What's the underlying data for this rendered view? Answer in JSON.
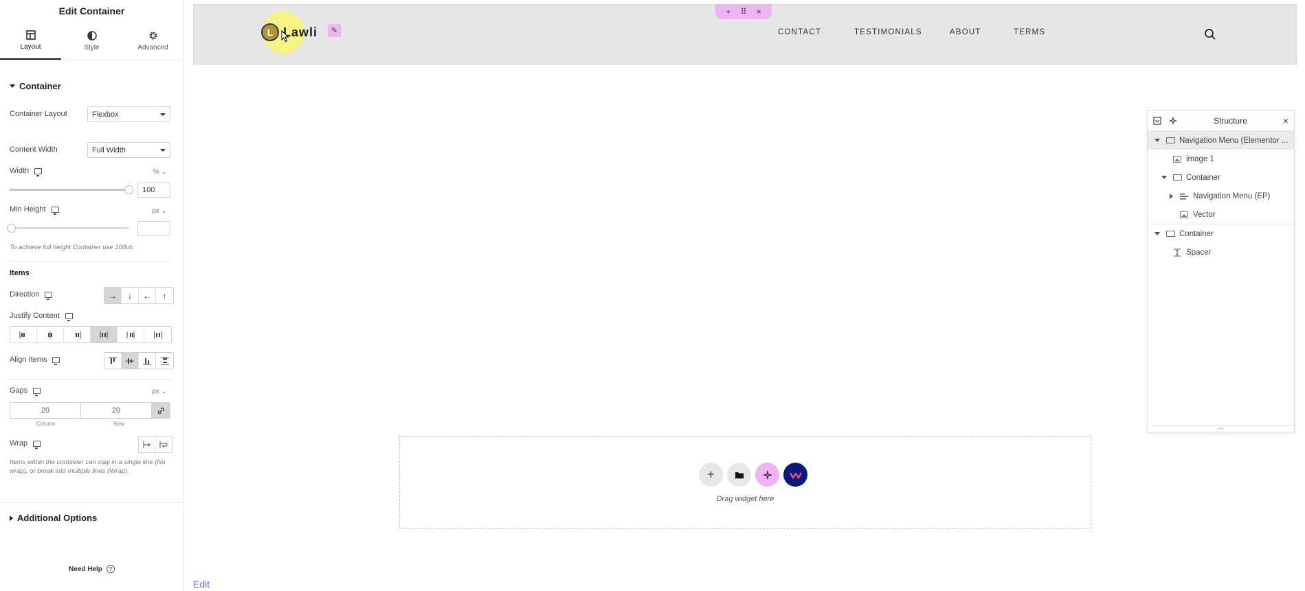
{
  "panel": {
    "title": "Edit Container",
    "tabs": [
      {
        "label": "Layout",
        "icon": "layout-icon",
        "active": true
      },
      {
        "label": "Style",
        "icon": "style-icon"
      },
      {
        "label": "Advanced",
        "icon": "gear-icon"
      }
    ],
    "section_container": "Container",
    "container_layout": {
      "label": "Container Layout",
      "value": "Flexbox"
    },
    "content_width": {
      "label": "Content Width",
      "value": "Full Width"
    },
    "width": {
      "label": "Width",
      "unit": "%",
      "value": "100",
      "slider_fraction": 1.0
    },
    "min_height": {
      "label": "Min Height",
      "unit": "px",
      "value": "",
      "hint": "To achieve full height Container use 100vh."
    },
    "items_heading": "Items",
    "direction": {
      "label": "Direction",
      "options": [
        "→",
        "↓",
        "←",
        "↑"
      ],
      "selected": 0
    },
    "justify_content": {
      "label": "Justify Content",
      "selected": 3
    },
    "align_items": {
      "label": "Align Items",
      "selected": 1
    },
    "gaps": {
      "label": "Gaps",
      "unit": "px",
      "column": "20",
      "row": "20",
      "column_label": "Column",
      "row_label": "Row"
    },
    "wrap": {
      "label": "Wrap",
      "hint": "Items within the container can stay in a single line (No wrap), or break into multiple lines (Wrap)."
    },
    "additional_options": "Additional Options",
    "need_help": "Need Help"
  },
  "canvas": {
    "logo_letter": "L",
    "logo_text": "Lawli",
    "nav_items": [
      "CONTACT",
      "TESTIMONIALS",
      "ABOUT",
      "TERMS"
    ],
    "handle_buttons": [
      "+",
      "⠿",
      "×"
    ],
    "drop_label": "Drag widget here",
    "edit_link": "Edit",
    "colors": {
      "accent_pink": "#f0b4f5",
      "logo_gold": "#b29530",
      "navy": "#0a1a7a",
      "link_purple": "#7e6cd8"
    }
  },
  "structure": {
    "title": "Structure",
    "foot": "...",
    "rows": [
      {
        "label": "Navigation Menu (Elementor ...",
        "icon": "container-icon",
        "toggle": "open",
        "level": 0,
        "selected": true
      },
      {
        "label": "image 1",
        "icon": "image-icon",
        "level": 1
      },
      {
        "label": "Container",
        "icon": "container-icon",
        "toggle": "open",
        "level": 1
      },
      {
        "label": "Navigation Menu (EP)",
        "icon": "nav-menu-icon",
        "toggle": "closed",
        "level": 2
      },
      {
        "label": "Vector",
        "icon": "image-icon",
        "level": 2
      },
      {
        "label": "Container",
        "icon": "container-icon",
        "toggle": "open",
        "level": 0,
        "separator_before": true
      },
      {
        "label": "Spacer",
        "icon": "spacer-icon",
        "level": 1
      }
    ]
  }
}
